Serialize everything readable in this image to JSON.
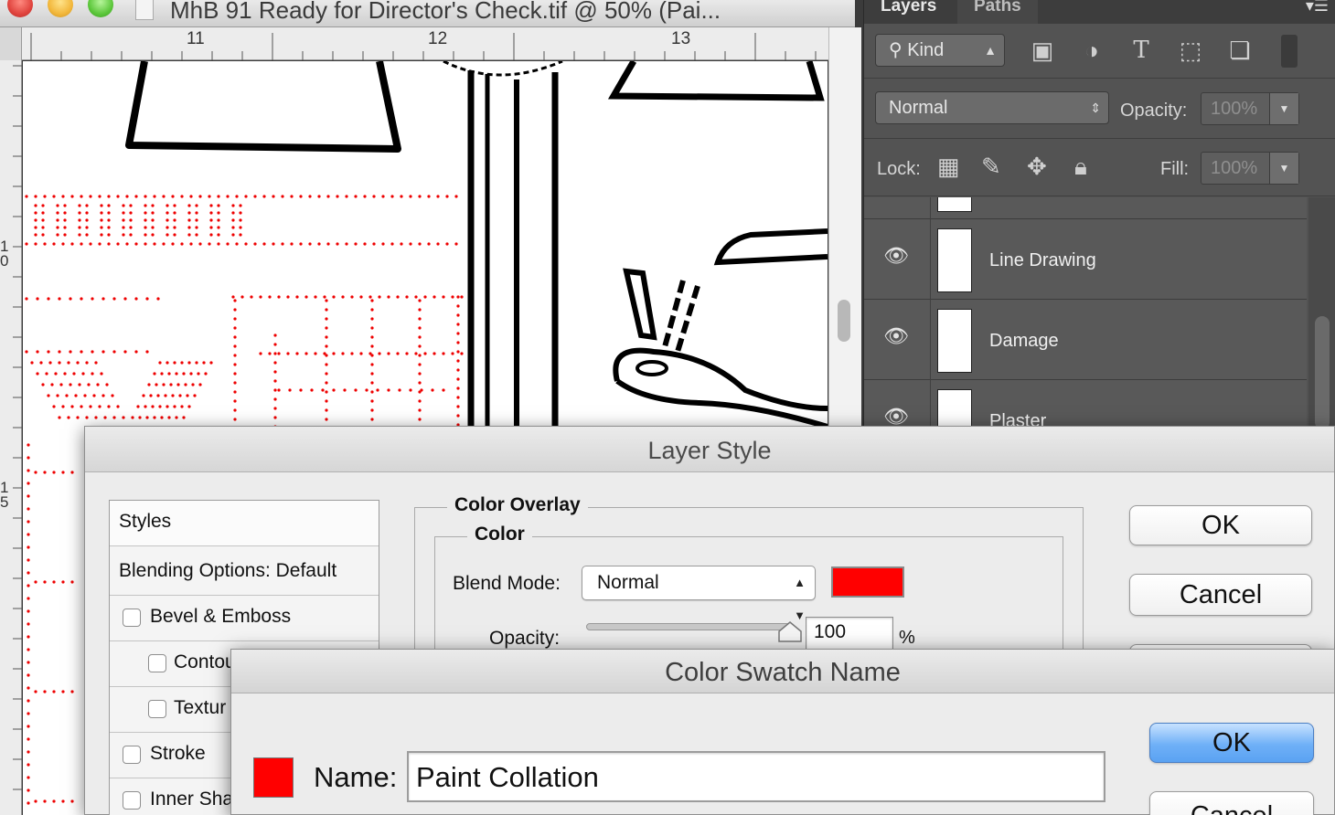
{
  "document": {
    "title": "MhB 91 Ready for Director's Check.tif @ 50% (Pai...",
    "ruler_marks": [
      "11",
      "12",
      "13"
    ],
    "ruler_left_marks": [
      "1 0",
      "1 5"
    ]
  },
  "layers_panel": {
    "tabs": [
      "Layers",
      "Paths"
    ],
    "filter_kind": "Kind",
    "blend_mode": "Normal",
    "opacity_label": "Opacity:",
    "opacity_value": "100%",
    "lock_label": "Lock:",
    "fill_label": "Fill:",
    "fill_value": "100%",
    "layers": [
      {
        "name": "Line Drawing",
        "visible": true
      },
      {
        "name": "Damage",
        "visible": true
      },
      {
        "name": "Plaster",
        "visible": true
      }
    ]
  },
  "layer_style": {
    "title": "Layer Style",
    "styles_header": "Styles",
    "blending_options": "Blending Options: Default",
    "effects": [
      {
        "label": "Bevel & Emboss",
        "checked": false
      },
      {
        "label": "Contou",
        "checked": false
      },
      {
        "label": "Textur",
        "checked": false
      },
      {
        "label": "Stroke",
        "checked": false
      },
      {
        "label": "Inner Sha",
        "checked": false
      }
    ],
    "section_title": "Color Overlay",
    "subsection_title": "Color",
    "blend_mode_label": "Blend Mode:",
    "blend_mode_value": "Normal",
    "overlay_color": "#ff0000",
    "opacity_label": "Opacity:",
    "opacity_value": "100",
    "opacity_fraction": 1.0,
    "percent": "%",
    "ok_label": "OK",
    "cancel_label": "Cancel"
  },
  "swatch_dialog": {
    "title": "Color Swatch Name",
    "name_label": "Name:",
    "name_value": "Paint Collation",
    "swatch_color": "#ff0000",
    "ok_label": "OK",
    "cancel_label": "Cancel"
  }
}
